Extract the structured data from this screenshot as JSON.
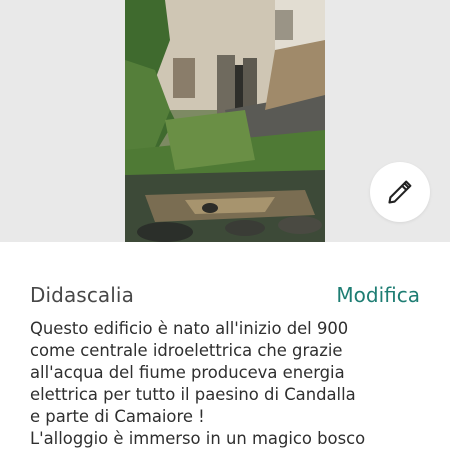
{
  "photo": {
    "icon": "river-building-photo"
  },
  "edit_fab": {
    "icon": "pencil-icon"
  },
  "caption": {
    "label": "Didascalia",
    "edit_label": "Modifica",
    "text": "Questo edificio è nato all'inizio del 900\ncome centrale idroelettrica che grazie\nall'acqua del fiume produceva energia\nelettrica per tutto il paesino di Candalla\ne parte di Camaiore !\nL'alloggio è immerso in un magico bosco"
  },
  "colors": {
    "accent": "#1e7d73",
    "label": "#484848",
    "body_text": "#2f2f2f",
    "photo_background": "#e9e9e9"
  }
}
